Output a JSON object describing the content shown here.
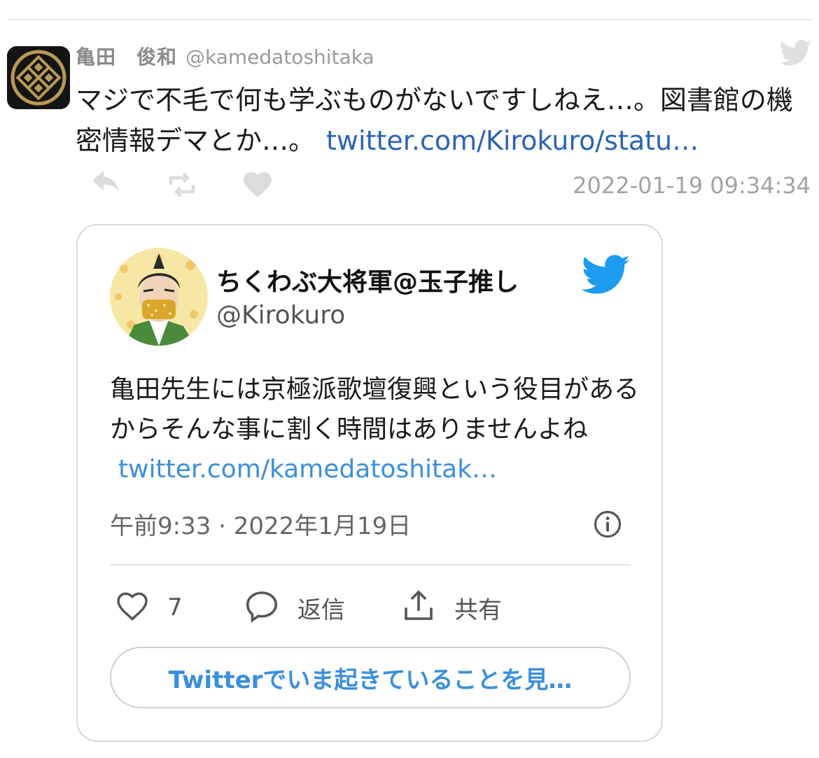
{
  "tweet": {
    "author_name": "亀田　俊和",
    "author_handle": "@kamedatoshitaka",
    "text": "マジで不毛で何も学ぶものがないですしねえ…。図書館の機密情報デマとか…。",
    "link": "twitter.com/Kirokuro/statu…",
    "timestamp": "2022-01-19 09:34:34"
  },
  "embed": {
    "author_name": "ちくわぶ大将軍@玉子推し",
    "author_handle": "@Kirokuro",
    "text": "亀田先生には京極派歌壇復興という役目があるからそんな事に割く時間はありませんよね",
    "link": "twitter.com/kamedatoshitak…",
    "meta": "午前9:33 · 2022年1月19日",
    "like_count": "7",
    "reply_label": "返信",
    "share_label": "共有",
    "cta_label": "Twitterでいま起きていることを見…"
  },
  "icons": {
    "bird_light": "twitter-bird-icon",
    "bird_card": "twitter-bird-icon",
    "reply": "reply-icon",
    "retweet": "retweet-icon",
    "like": "heart-icon",
    "info": "info-icon",
    "comment": "comment-icon",
    "share": "share-icon"
  },
  "colors": {
    "link_dark": "#2b63b5",
    "link_light": "#3b8fdc",
    "twitter_blue": "#1d9bf0",
    "muted": "#a3a3a3"
  }
}
